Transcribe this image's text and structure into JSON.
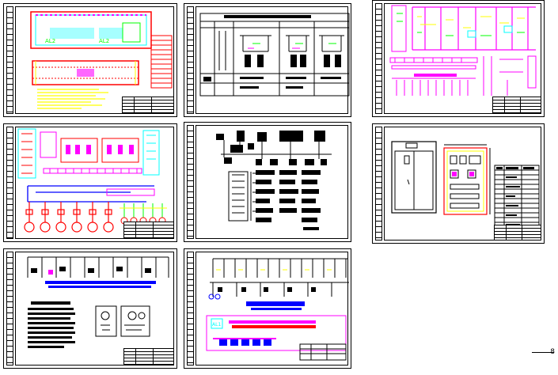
{
  "sheets": [
    {
      "id": "sheet-1",
      "type": "site-layout"
    },
    {
      "id": "sheet-2",
      "type": "panel-table"
    },
    {
      "id": "sheet-3",
      "type": "control-schematic"
    },
    {
      "id": "sheet-4",
      "type": "wiring-diagram"
    },
    {
      "id": "sheet-5",
      "type": "block-diagram"
    },
    {
      "id": "sheet-6",
      "type": "cabinet-layout"
    },
    {
      "id": "sheet-7",
      "type": "notes-and-schematic"
    },
    {
      "id": "sheet-8",
      "type": "terminal-diagram"
    }
  ],
  "labels": {
    "sheet1_box_a": "AL2",
    "sheet1_box_b": "AL2",
    "sheet8_box": "AL1",
    "sheet5_box": "AL1"
  },
  "colors": {
    "ink": "#000000",
    "red": "#ff0000",
    "magenta": "#ff00ff",
    "cyan": "#00ffff",
    "yellow": "#ffff00",
    "green": "#00ff00",
    "blue": "#0000ff"
  },
  "scale_mark": "8"
}
